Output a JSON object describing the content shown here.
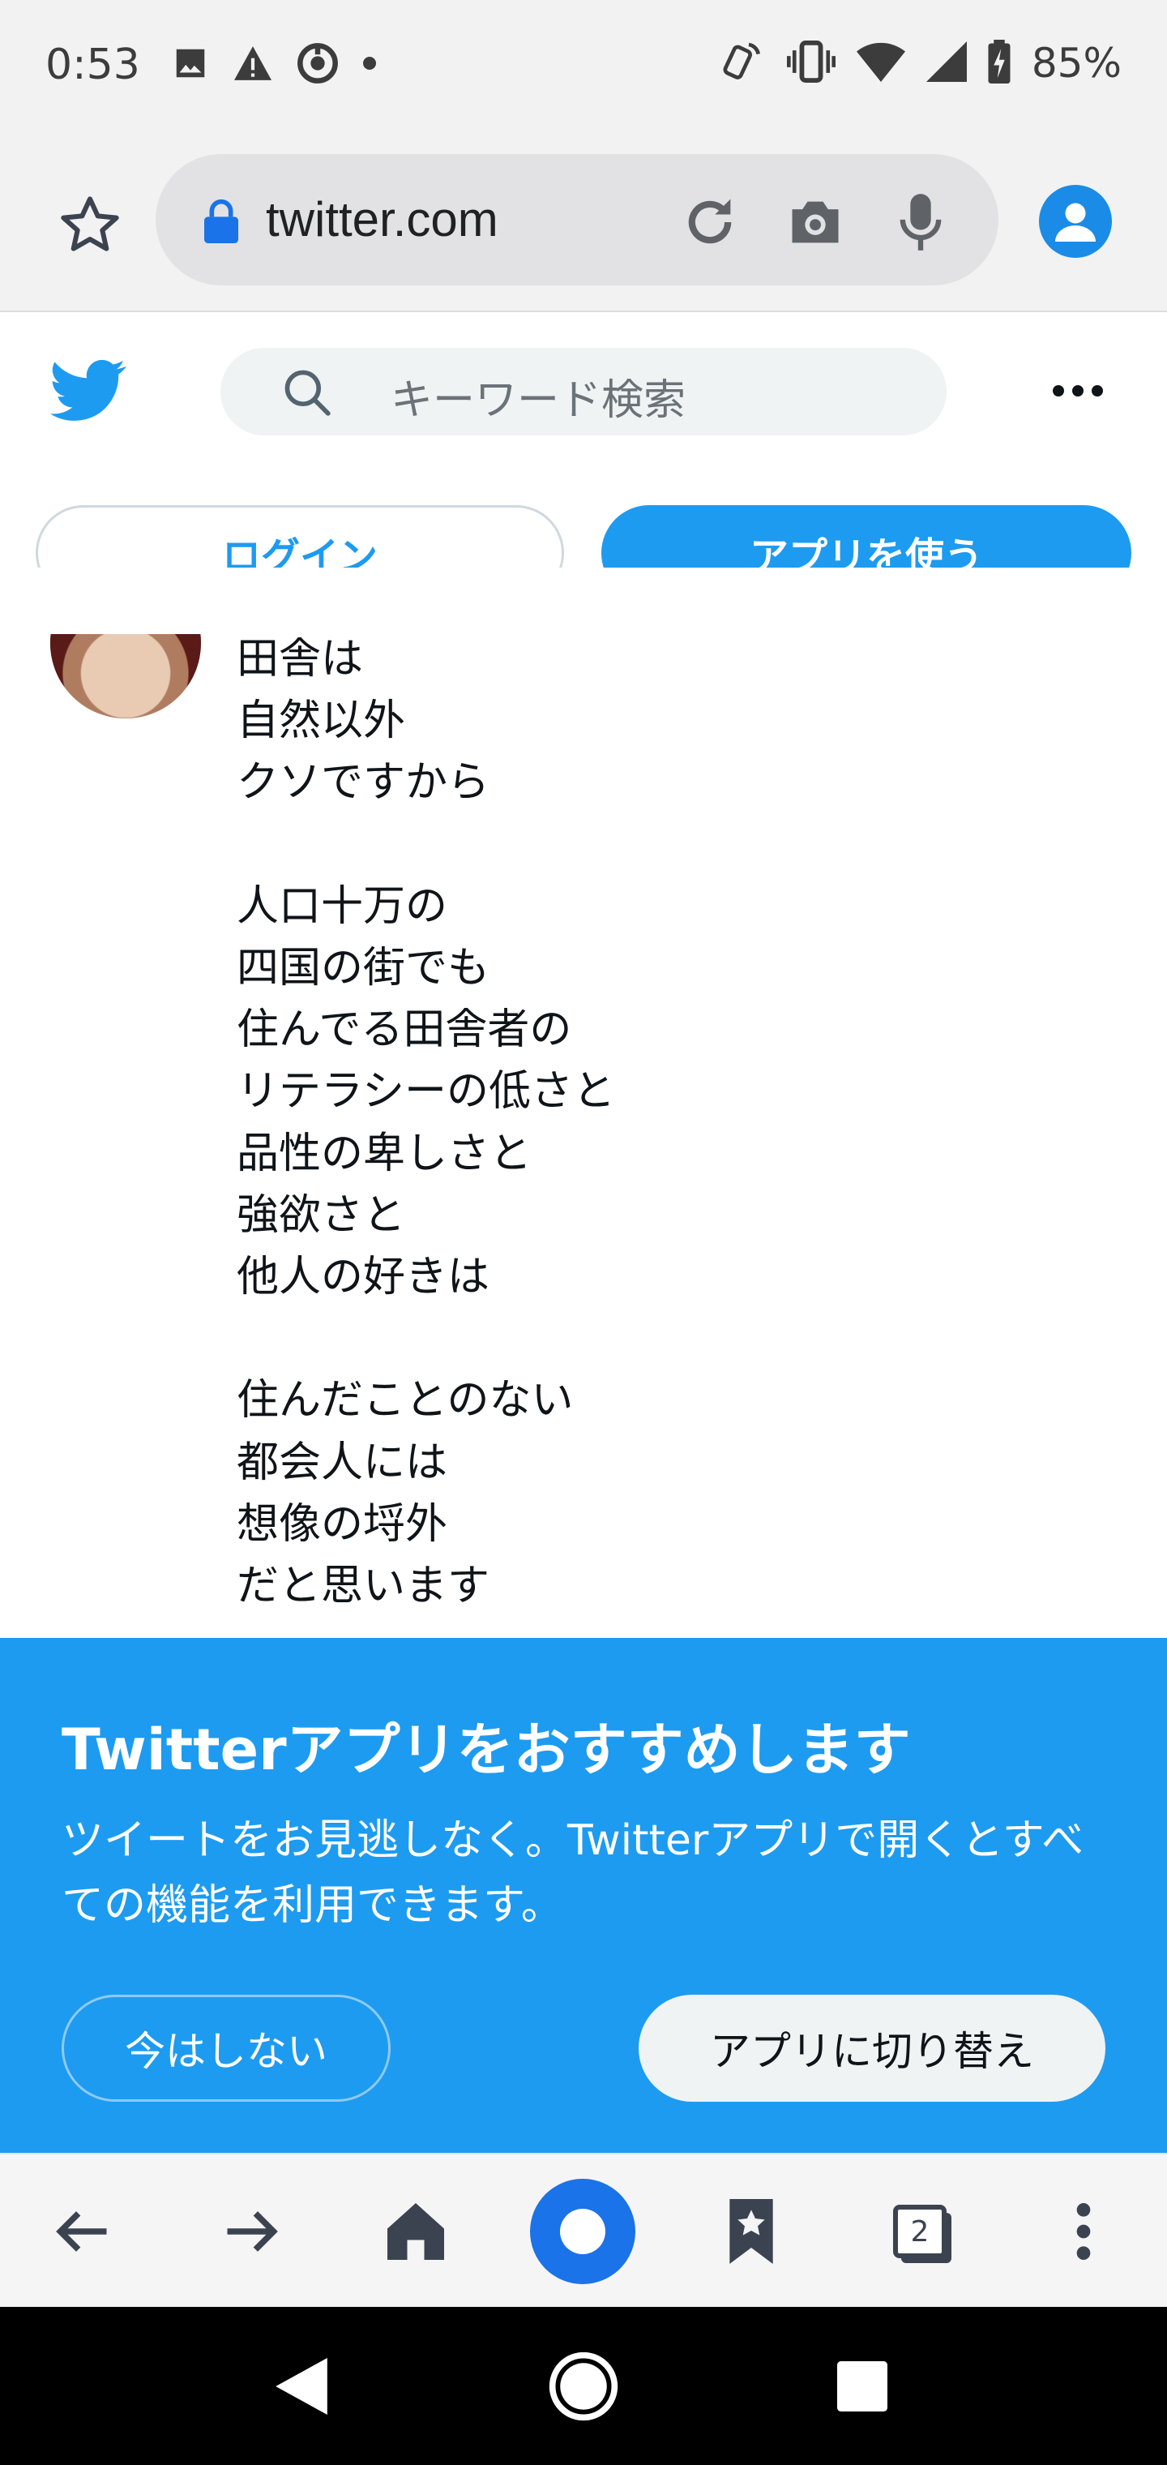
{
  "status_bar": {
    "time": "0:53",
    "battery": "85%",
    "left_icons": [
      "image-icon",
      "warning-icon",
      "sync-icon",
      "dot-icon"
    ],
    "right_icons": [
      "nfc-icon",
      "vibrate-icon",
      "wifi-icon",
      "signal-icon",
      "battery-icon"
    ]
  },
  "browser": {
    "url": "twitter.com",
    "tab_count": "2"
  },
  "twitter": {
    "search_placeholder": "キーワード検索",
    "login_label": "ログイン",
    "use_app_label": "アプリを使う"
  },
  "tweet": {
    "text": "田舎は\n自然以外\nクソですから\n\n人口十万の\n四国の街でも\n住んでる田舎者の\nリテラシーの低さと\n品性の卑しさと\n強欲さと\n他人の好きは\n\n住んだことのない\n都会人には\n想像の埒外\nだと思います"
  },
  "app_banner": {
    "title": "Twitterアプリをおすすめします",
    "description": "ツイートをお見逃しなく。Twitterアプリで開くとすべての機能を利用できます。",
    "not_now_label": "今はしない",
    "switch_label": "アプリに切り替え"
  },
  "colors": {
    "twitter_blue": "#1d9bf0",
    "browser_blue": "#1a73e8"
  }
}
